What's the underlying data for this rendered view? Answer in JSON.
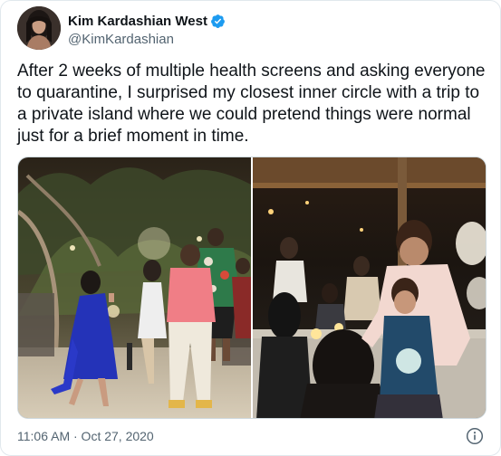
{
  "tweet": {
    "author": {
      "display_name": "Kim Kardashian West",
      "handle": "@KimKardashian",
      "verified": true,
      "avatar_icon": "profile-photo"
    },
    "text": "After 2 weeks of multiple health screens and asking everyone to quarantine, I surprised my closest inner circle with a trip to a private island where we could pretend things were normal just for a brief moment in time.",
    "media": [
      {
        "kind": "photo",
        "subject": "group walking on beach at night"
      },
      {
        "kind": "photo",
        "subject": "man hugging boy at dinner party"
      }
    ],
    "timestamp": "11:06 AM · Oct 27, 2020",
    "info_icon": "info-icon"
  },
  "colors": {
    "text": "#0f1419",
    "secondary_text": "#536471",
    "verified_blue": "#1d9bf0",
    "border": "#e1e8ed"
  }
}
